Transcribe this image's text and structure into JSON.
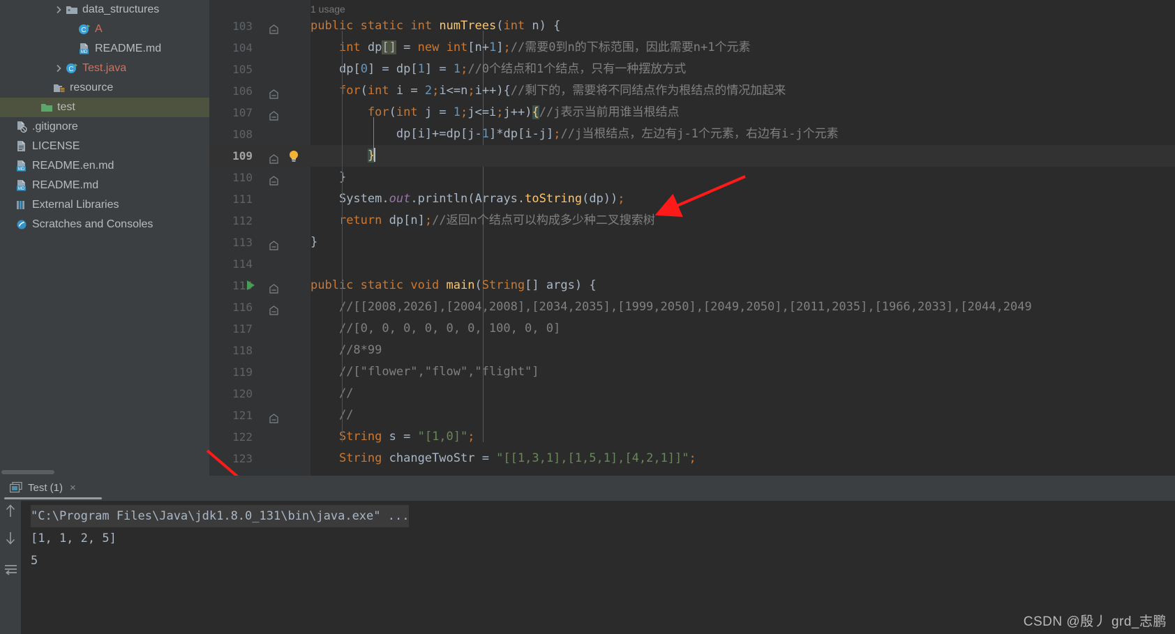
{
  "sidebar": {
    "items": [
      {
        "label": "data_structures",
        "icon": "folder-icon",
        "indent": 4,
        "arrow": "chevron-right-icon",
        "color": "normal",
        "selected": false
      },
      {
        "label": "A",
        "icon": "java-class-icon",
        "indent": 5,
        "arrow": "",
        "color": "rust",
        "selected": false
      },
      {
        "label": "README.md",
        "icon": "markdown-icon",
        "indent": 5,
        "arrow": "",
        "color": "normal",
        "selected": false
      },
      {
        "label": "Test.java",
        "icon": "java-class-icon",
        "indent": 4,
        "arrow": "chevron-right-icon",
        "color": "rust",
        "selected": false
      },
      {
        "label": "resource",
        "icon": "resource-folder-icon",
        "indent": 3,
        "arrow": "",
        "color": "normal",
        "selected": false
      },
      {
        "label": "test",
        "icon": "test-folder-icon",
        "indent": 2,
        "arrow": "",
        "color": "normal",
        "selected": true
      },
      {
        "label": ".gitignore",
        "icon": "gitignore-icon",
        "indent": 0,
        "arrow": "",
        "color": "normal",
        "selected": false
      },
      {
        "label": "LICENSE",
        "icon": "text-file-icon",
        "indent": 0,
        "arrow": "",
        "color": "normal",
        "selected": false
      },
      {
        "label": "README.en.md",
        "icon": "markdown-icon",
        "indent": 0,
        "arrow": "",
        "color": "normal",
        "selected": false
      },
      {
        "label": "README.md",
        "icon": "markdown-icon",
        "indent": 0,
        "arrow": "",
        "color": "normal",
        "selected": false
      },
      {
        "label": "External Libraries",
        "icon": "library-icon",
        "indent": 0,
        "arrow": "",
        "color": "normal",
        "selected": false
      },
      {
        "label": "Scratches and Consoles",
        "icon": "scratches-icon",
        "indent": 0,
        "arrow": "",
        "color": "normal",
        "selected": false
      }
    ]
  },
  "editor": {
    "usage_hint": "1 usage",
    "first_line_number": 103,
    "current_line": 109,
    "lines": [
      {
        "num": 103,
        "fold": true,
        "run": false,
        "bulb": false,
        "text": "public static int numTrees(int n) {"
      },
      {
        "num": 104,
        "fold": false,
        "run": false,
        "bulb": false,
        "text": "    int dp[] = new int[n+1];//需要0到n的下标范围，因此需要n+1个元素"
      },
      {
        "num": 105,
        "fold": false,
        "run": false,
        "bulb": false,
        "text": "    dp[0] = dp[1] = 1;//0个结点和1个结点，只有一种摆放方式"
      },
      {
        "num": 106,
        "fold": true,
        "run": false,
        "bulb": false,
        "text": "    for(int i = 2;i<=n;i++){//剩下的，需要将不同结点作为根结点的情况加起来"
      },
      {
        "num": 107,
        "fold": true,
        "run": false,
        "bulb": false,
        "text": "        for(int j = 1;j<=i;j++){//j表示当前用谁当根结点"
      },
      {
        "num": 108,
        "fold": false,
        "run": false,
        "bulb": false,
        "text": "            dp[i]+=dp[j-1]*dp[i-j];//j当根结点，左边有j-1个元素，右边有i-j个元素"
      },
      {
        "num": 109,
        "fold": true,
        "run": false,
        "bulb": true,
        "text": "        }"
      },
      {
        "num": 110,
        "fold": true,
        "run": false,
        "bulb": false,
        "text": "    }"
      },
      {
        "num": 111,
        "fold": false,
        "run": false,
        "bulb": false,
        "text": "    System.out.println(Arrays.toString(dp));"
      },
      {
        "num": 112,
        "fold": false,
        "run": false,
        "bulb": false,
        "text": "    return dp[n];//返回n个结点可以构成多少种二叉搜索树"
      },
      {
        "num": 113,
        "fold": true,
        "run": false,
        "bulb": false,
        "text": "}"
      },
      {
        "num": 114,
        "fold": false,
        "run": false,
        "bulb": false,
        "text": ""
      },
      {
        "num": 115,
        "fold": true,
        "run": true,
        "bulb": false,
        "text": "public static void main(String[] args) {"
      },
      {
        "num": 116,
        "fold": true,
        "run": false,
        "bulb": false,
        "text": "    //[[2008,2026],[2004,2008],[2034,2035],[1999,2050],[2049,2050],[2011,2035],[1966,2033],[2044,2049"
      },
      {
        "num": 117,
        "fold": false,
        "run": false,
        "bulb": false,
        "text": "    //[0, 0, 0, 0, 0, 0, 100, 0, 0]"
      },
      {
        "num": 118,
        "fold": false,
        "run": false,
        "bulb": false,
        "text": "    //8*99"
      },
      {
        "num": 119,
        "fold": false,
        "run": false,
        "bulb": false,
        "text": "    //[\"flower\",\"flow\",\"flight\"]"
      },
      {
        "num": 120,
        "fold": false,
        "run": false,
        "bulb": false,
        "text": "    //"
      },
      {
        "num": 121,
        "fold": true,
        "run": false,
        "bulb": false,
        "text": "    //"
      },
      {
        "num": 122,
        "fold": false,
        "run": false,
        "bulb": false,
        "text": "    String s = \"[1,0]\";"
      },
      {
        "num": 123,
        "fold": false,
        "run": false,
        "bulb": false,
        "text": "    String changeTwoStr = \"[[1,3,1],[1,5,1],[4,2,1]]\";"
      }
    ]
  },
  "console": {
    "tab_label": "Test (1)",
    "tab_close": "×",
    "tool_icons": [
      "scroll-up-icon",
      "scroll-down-icon",
      "soft-wrap-icon"
    ],
    "output": [
      {
        "text": "\"C:\\Program Files\\Java\\jdk1.8.0_131\\bin\\java.exe\" ...",
        "highlight": true
      },
      {
        "text": "[1, 1, 2, 5]",
        "highlight": false
      },
      {
        "text": "5",
        "highlight": false
      }
    ]
  },
  "watermark": "CSDN @殷丿 grd_志鹏",
  "colors": {
    "sidebar_bg": "#3c3f41",
    "editor_bg": "#2b2b2b",
    "gutter_bg": "#313335",
    "selection": "#4e5340",
    "keyword": "#cc7832",
    "number": "#6897bb",
    "comment": "#808080",
    "string": "#6a8759",
    "method": "#ffc66d",
    "field": "#9876aa",
    "text": "#a9b7c6",
    "annotation_arrow": "#ff1a1a"
  }
}
